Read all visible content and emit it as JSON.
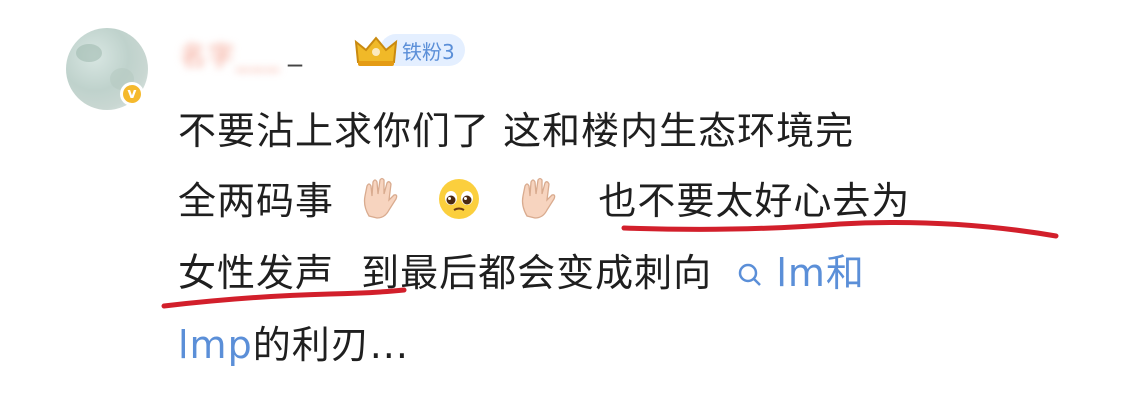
{
  "comment": {
    "user": {
      "name": "名字___",
      "name_suffix": "_",
      "fan_badge": "铁粉3"
    },
    "lines": [
      "不要沾上求你们了 这和楼内生态环境完",
      "全两码事",
      "也不要太好心去为",
      "女性发声",
      "到最后都会变成刺向",
      "lm和",
      "lmp",
      "的利刃..."
    ],
    "emojis": [
      "raised-hand",
      "pleading-face",
      "raised-hand"
    ],
    "colors": {
      "link": "#5b8fd8",
      "underline": "#d21f2b",
      "badge_bg": "#e4efff",
      "verify": "#f5b92d"
    }
  }
}
